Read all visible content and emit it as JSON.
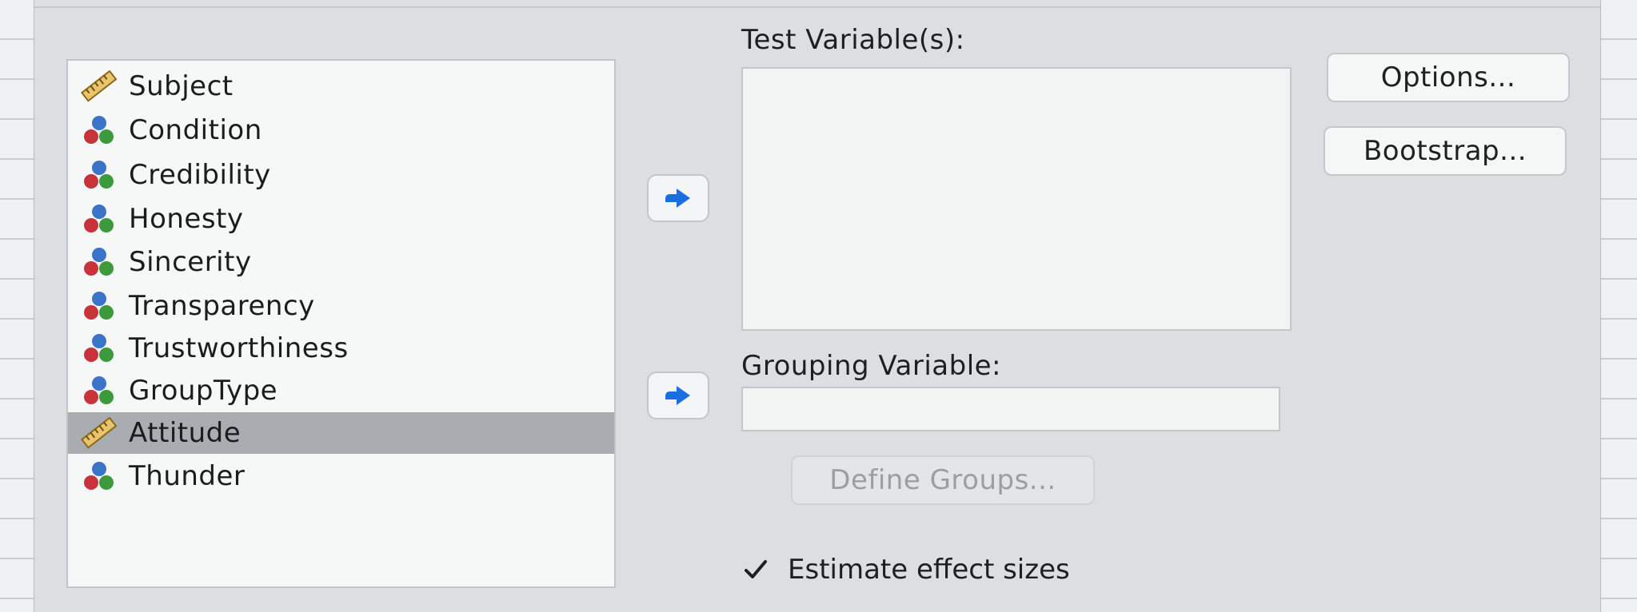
{
  "variables": [
    {
      "label": "Subject",
      "type": "scale",
      "icon": "ruler-icon"
    },
    {
      "label": "Condition",
      "type": "nominal",
      "icon": "nominal-icon"
    },
    {
      "label": "Credibility",
      "type": "nominal",
      "icon": "nominal-icon"
    },
    {
      "label": "Honesty",
      "type": "nominal",
      "icon": "nominal-icon"
    },
    {
      "label": "Sincerity",
      "type": "nominal",
      "icon": "nominal-icon"
    },
    {
      "label": "Transparency",
      "type": "nominal",
      "icon": "nominal-icon"
    },
    {
      "label": "Trustworthiness",
      "type": "nominal",
      "icon": "nominal-icon"
    },
    {
      "label": "GroupType",
      "type": "nominal",
      "icon": "nominal-icon"
    },
    {
      "label": "Attitude",
      "type": "scale",
      "icon": "ruler-icon",
      "selected": true
    },
    {
      "label": "Thunder",
      "type": "nominal",
      "icon": "nominal-icon"
    }
  ],
  "test_variables": {
    "label": "Test Variable(s):",
    "items": []
  },
  "grouping_variable": {
    "label": "Grouping Variable:",
    "value": ""
  },
  "buttons": {
    "options": "Options...",
    "bootstrap": "Bootstrap...",
    "define_groups": "Define Groups..."
  },
  "estimate_effect_sizes": {
    "label": "Estimate effect sizes",
    "checked": true
  },
  "colors": {
    "arrow": "#1a6fe0",
    "selection": "#a9acb1"
  }
}
